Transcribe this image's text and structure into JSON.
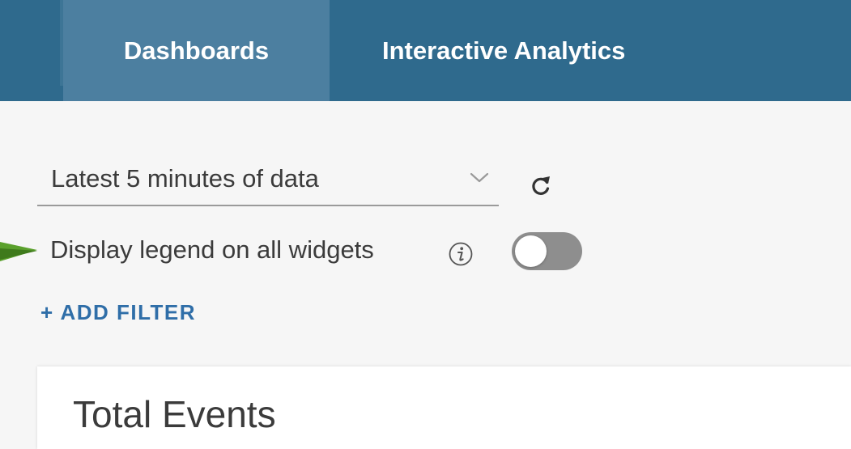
{
  "nav": {
    "tabs": [
      {
        "label": "Dashboards",
        "active": true
      },
      {
        "label": "Interactive Analytics",
        "active": false
      }
    ]
  },
  "controls": {
    "time_range": {
      "selected": "Latest 5 minutes of data",
      "icon": "chevron-down-icon"
    },
    "refresh_icon": "refresh-icon",
    "legend_toggle": {
      "label": "Display legend on all widgets",
      "info_icon": "info-icon",
      "state": "off"
    },
    "add_filter_label": "+ ADD FILTER"
  },
  "widget": {
    "title": "Total Events"
  },
  "colors": {
    "header_bg": "#2f6a8d",
    "active_tab_bg": "#4c7fa0",
    "link_blue": "#2f6ea8",
    "annotation_arrow": "#5aa02c",
    "toggle_off": "#8e8e8e"
  }
}
